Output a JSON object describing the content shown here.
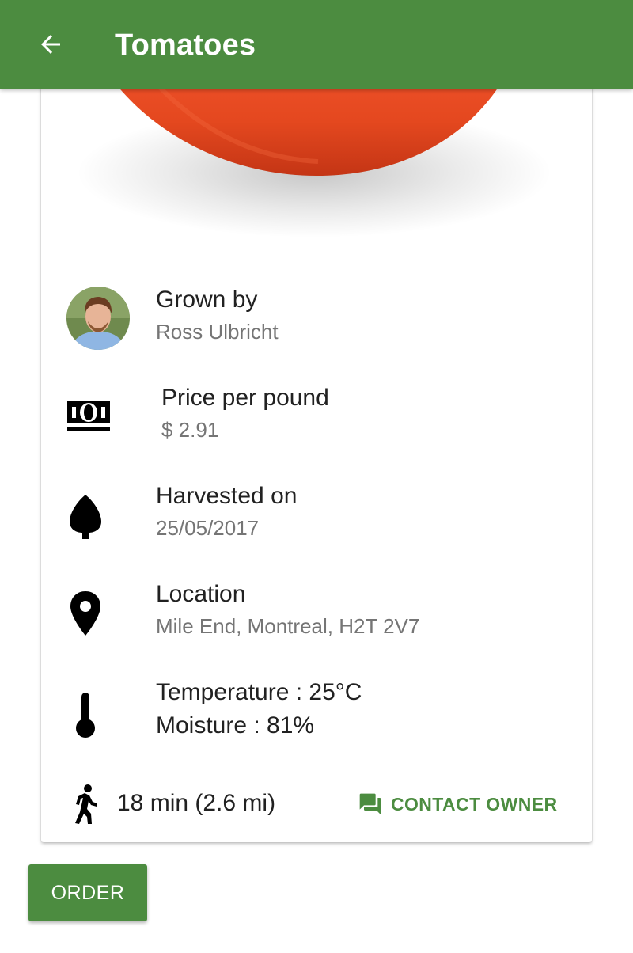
{
  "appbar": {
    "title": "Tomatoes",
    "back_icon": "arrow-back-icon",
    "color": "#4c8c40"
  },
  "product": {
    "image_subject": "tomato"
  },
  "details": {
    "grower": {
      "label": "Grown by",
      "value": "Ross Ulbricht",
      "icon": "avatar-photo"
    },
    "price": {
      "label": "Price per pound",
      "value": "$ 2.91",
      "icon": "money-icon"
    },
    "harvest": {
      "label": "Harvested on",
      "value": "25/05/2017",
      "icon": "leaf-icon"
    },
    "location": {
      "label": "Location",
      "value": "Mile End, Montreal, H2T 2V7",
      "icon": "location-pin-icon"
    },
    "conditions": {
      "temperature": "Temperature : 25°C",
      "moisture": "Moisture : 81%",
      "icon": "thermometer-icon"
    }
  },
  "footer": {
    "distance": "18 min  (2.6 mi)",
    "distance_icon": "walking-icon",
    "contact_label": "CONTACT OWNER",
    "contact_icon": "chat-icon"
  },
  "order_button": {
    "label": "ORDER"
  }
}
